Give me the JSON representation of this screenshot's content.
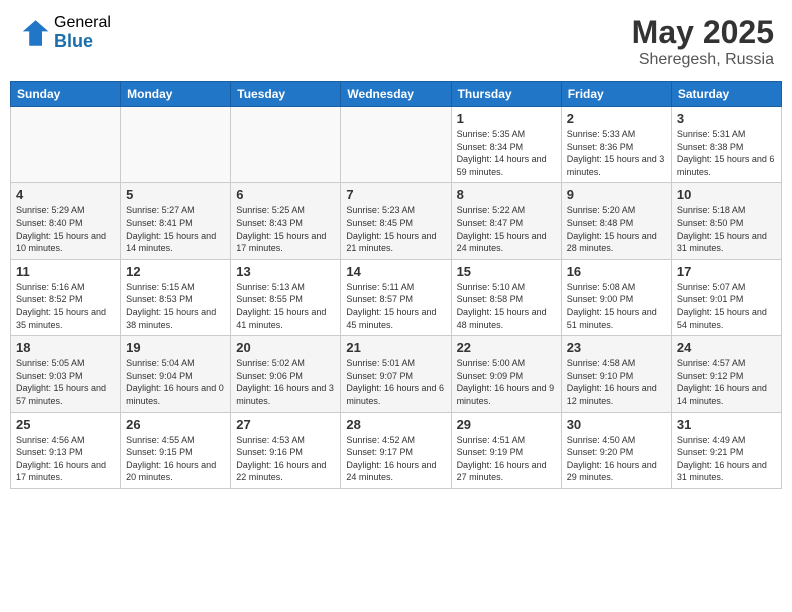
{
  "header": {
    "logo_general": "General",
    "logo_blue": "Blue",
    "month_year": "May 2025",
    "location": "Sheregesh, Russia"
  },
  "weekdays": [
    "Sunday",
    "Monday",
    "Tuesday",
    "Wednesday",
    "Thursday",
    "Friday",
    "Saturday"
  ],
  "rows": [
    [
      {
        "day": "",
        "sunrise": "",
        "sunset": "",
        "daylight": ""
      },
      {
        "day": "",
        "sunrise": "",
        "sunset": "",
        "daylight": ""
      },
      {
        "day": "",
        "sunrise": "",
        "sunset": "",
        "daylight": ""
      },
      {
        "day": "",
        "sunrise": "",
        "sunset": "",
        "daylight": ""
      },
      {
        "day": "1",
        "sunrise": "Sunrise: 5:35 AM",
        "sunset": "Sunset: 8:34 PM",
        "daylight": "Daylight: 14 hours and 59 minutes."
      },
      {
        "day": "2",
        "sunrise": "Sunrise: 5:33 AM",
        "sunset": "Sunset: 8:36 PM",
        "daylight": "Daylight: 15 hours and 3 minutes."
      },
      {
        "day": "3",
        "sunrise": "Sunrise: 5:31 AM",
        "sunset": "Sunset: 8:38 PM",
        "daylight": "Daylight: 15 hours and 6 minutes."
      }
    ],
    [
      {
        "day": "4",
        "sunrise": "Sunrise: 5:29 AM",
        "sunset": "Sunset: 8:40 PM",
        "daylight": "Daylight: 15 hours and 10 minutes."
      },
      {
        "day": "5",
        "sunrise": "Sunrise: 5:27 AM",
        "sunset": "Sunset: 8:41 PM",
        "daylight": "Daylight: 15 hours and 14 minutes."
      },
      {
        "day": "6",
        "sunrise": "Sunrise: 5:25 AM",
        "sunset": "Sunset: 8:43 PM",
        "daylight": "Daylight: 15 hours and 17 minutes."
      },
      {
        "day": "7",
        "sunrise": "Sunrise: 5:23 AM",
        "sunset": "Sunset: 8:45 PM",
        "daylight": "Daylight: 15 hours and 21 minutes."
      },
      {
        "day": "8",
        "sunrise": "Sunrise: 5:22 AM",
        "sunset": "Sunset: 8:47 PM",
        "daylight": "Daylight: 15 hours and 24 minutes."
      },
      {
        "day": "9",
        "sunrise": "Sunrise: 5:20 AM",
        "sunset": "Sunset: 8:48 PM",
        "daylight": "Daylight: 15 hours and 28 minutes."
      },
      {
        "day": "10",
        "sunrise": "Sunrise: 5:18 AM",
        "sunset": "Sunset: 8:50 PM",
        "daylight": "Daylight: 15 hours and 31 minutes."
      }
    ],
    [
      {
        "day": "11",
        "sunrise": "Sunrise: 5:16 AM",
        "sunset": "Sunset: 8:52 PM",
        "daylight": "Daylight: 15 hours and 35 minutes."
      },
      {
        "day": "12",
        "sunrise": "Sunrise: 5:15 AM",
        "sunset": "Sunset: 8:53 PM",
        "daylight": "Daylight: 15 hours and 38 minutes."
      },
      {
        "day": "13",
        "sunrise": "Sunrise: 5:13 AM",
        "sunset": "Sunset: 8:55 PM",
        "daylight": "Daylight: 15 hours and 41 minutes."
      },
      {
        "day": "14",
        "sunrise": "Sunrise: 5:11 AM",
        "sunset": "Sunset: 8:57 PM",
        "daylight": "Daylight: 15 hours and 45 minutes."
      },
      {
        "day": "15",
        "sunrise": "Sunrise: 5:10 AM",
        "sunset": "Sunset: 8:58 PM",
        "daylight": "Daylight: 15 hours and 48 minutes."
      },
      {
        "day": "16",
        "sunrise": "Sunrise: 5:08 AM",
        "sunset": "Sunset: 9:00 PM",
        "daylight": "Daylight: 15 hours and 51 minutes."
      },
      {
        "day": "17",
        "sunrise": "Sunrise: 5:07 AM",
        "sunset": "Sunset: 9:01 PM",
        "daylight": "Daylight: 15 hours and 54 minutes."
      }
    ],
    [
      {
        "day": "18",
        "sunrise": "Sunrise: 5:05 AM",
        "sunset": "Sunset: 9:03 PM",
        "daylight": "Daylight: 15 hours and 57 minutes."
      },
      {
        "day": "19",
        "sunrise": "Sunrise: 5:04 AM",
        "sunset": "Sunset: 9:04 PM",
        "daylight": "Daylight: 16 hours and 0 minutes."
      },
      {
        "day": "20",
        "sunrise": "Sunrise: 5:02 AM",
        "sunset": "Sunset: 9:06 PM",
        "daylight": "Daylight: 16 hours and 3 minutes."
      },
      {
        "day": "21",
        "sunrise": "Sunrise: 5:01 AM",
        "sunset": "Sunset: 9:07 PM",
        "daylight": "Daylight: 16 hours and 6 minutes."
      },
      {
        "day": "22",
        "sunrise": "Sunrise: 5:00 AM",
        "sunset": "Sunset: 9:09 PM",
        "daylight": "Daylight: 16 hours and 9 minutes."
      },
      {
        "day": "23",
        "sunrise": "Sunrise: 4:58 AM",
        "sunset": "Sunset: 9:10 PM",
        "daylight": "Daylight: 16 hours and 12 minutes."
      },
      {
        "day": "24",
        "sunrise": "Sunrise: 4:57 AM",
        "sunset": "Sunset: 9:12 PM",
        "daylight": "Daylight: 16 hours and 14 minutes."
      }
    ],
    [
      {
        "day": "25",
        "sunrise": "Sunrise: 4:56 AM",
        "sunset": "Sunset: 9:13 PM",
        "daylight": "Daylight: 16 hours and 17 minutes."
      },
      {
        "day": "26",
        "sunrise": "Sunrise: 4:55 AM",
        "sunset": "Sunset: 9:15 PM",
        "daylight": "Daylight: 16 hours and 20 minutes."
      },
      {
        "day": "27",
        "sunrise": "Sunrise: 4:53 AM",
        "sunset": "Sunset: 9:16 PM",
        "daylight": "Daylight: 16 hours and 22 minutes."
      },
      {
        "day": "28",
        "sunrise": "Sunrise: 4:52 AM",
        "sunset": "Sunset: 9:17 PM",
        "daylight": "Daylight: 16 hours and 24 minutes."
      },
      {
        "day": "29",
        "sunrise": "Sunrise: 4:51 AM",
        "sunset": "Sunset: 9:19 PM",
        "daylight": "Daylight: 16 hours and 27 minutes."
      },
      {
        "day": "30",
        "sunrise": "Sunrise: 4:50 AM",
        "sunset": "Sunset: 9:20 PM",
        "daylight": "Daylight: 16 hours and 29 minutes."
      },
      {
        "day": "31",
        "sunrise": "Sunrise: 4:49 AM",
        "sunset": "Sunset: 9:21 PM",
        "daylight": "Daylight: 16 hours and 31 minutes."
      }
    ]
  ]
}
